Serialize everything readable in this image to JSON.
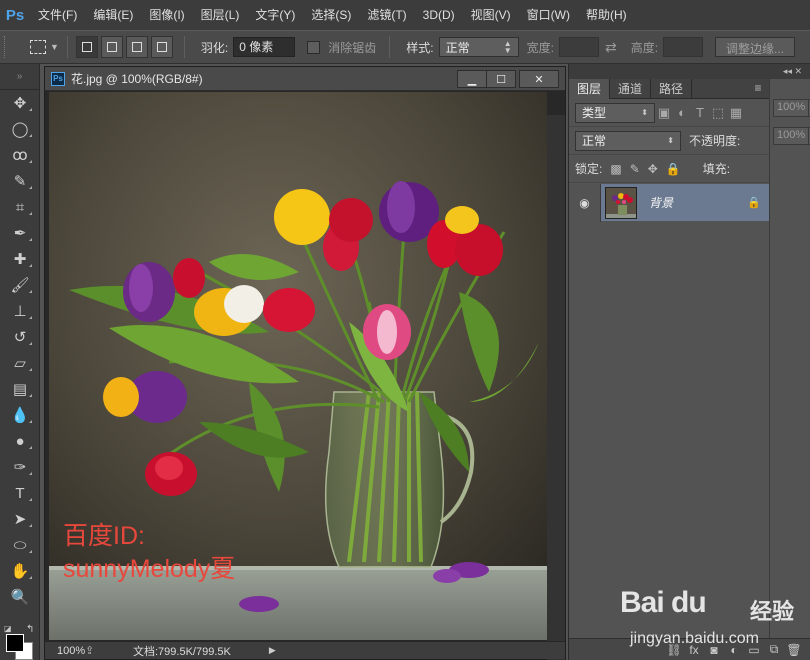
{
  "app": {
    "logo": "Ps"
  },
  "menu": [
    "文件(F)",
    "编辑(E)",
    "图像(I)",
    "图层(L)",
    "文字(Y)",
    "选择(S)",
    "滤镜(T)",
    "3D(D)",
    "视图(V)",
    "窗口(W)",
    "帮助(H)"
  ],
  "options": {
    "feather_label": "羽化:",
    "feather_value": "0 像素",
    "antialias_label": "消除锯齿",
    "style_label": "样式:",
    "style_value": "正常",
    "width_label": "宽度:",
    "height_label": "高度:",
    "refine_edge_label": "调整边缘..."
  },
  "document": {
    "title": "花.jpg @ 100%(RGB/8#)",
    "zoom": "100%",
    "doc_size": "文档:799.5K/799.5K",
    "watermark_line1": "百度ID:",
    "watermark_line2": "sunnyMelody夏"
  },
  "layers_panel": {
    "tabs": [
      "图层",
      "通道",
      "路径"
    ],
    "filter_kind": "类型",
    "blend_mode": "正常",
    "opacity_label": "不透明度:",
    "opacity_value": "100%",
    "lock_label": "锁定:",
    "fill_label": "填充:",
    "fill_value": "100%",
    "layer_name": "背景"
  },
  "site_watermark": {
    "logo": "Bai du",
    "label": "经验",
    "url": "jingyan.baidu.com"
  },
  "colors": {
    "accent": "#4fa3e8",
    "selected_layer": "#6b7a91",
    "watermark_text": "#e8473c"
  }
}
